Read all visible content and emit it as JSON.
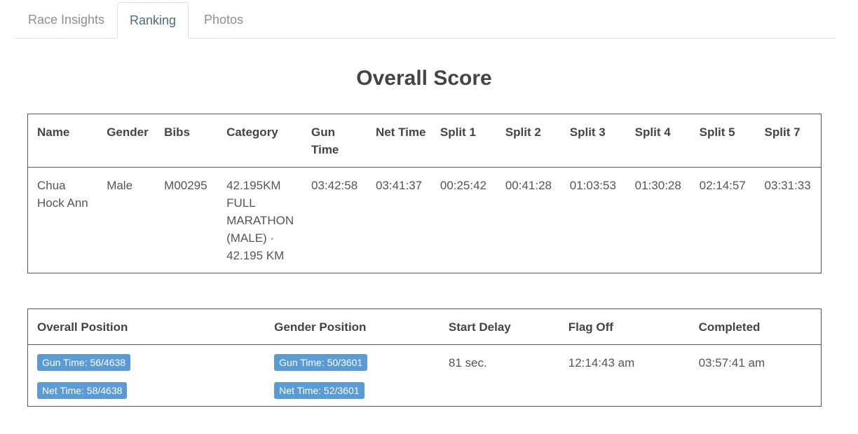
{
  "tabs": [
    {
      "label": "Race Insights"
    },
    {
      "label": "Ranking"
    },
    {
      "label": "Photos"
    }
  ],
  "title": "Overall Score",
  "score_table": {
    "headers": [
      "Name",
      "Gender",
      "Bibs",
      "Category",
      "Gun Time",
      "Net Time",
      "Split 1",
      "Split 2",
      "Split 3",
      "Split 4",
      "Split 5",
      "Split 7"
    ],
    "row": {
      "name": "Chua Hock Ann",
      "gender": "Male",
      "bib": "M00295",
      "category": "42.195KM FULL MARATHON (MALE) · 42.195 KM",
      "gun_time": "03:42:58",
      "net_time": "03:41:37",
      "split_1": "00:25:42",
      "split_2": "00:41:28",
      "split_3": "01:03:53",
      "split_4": "01:30:28",
      "split_5": "02:14:57",
      "split_7": "03:31:33"
    }
  },
  "position_table": {
    "headers": [
      "Overall Position",
      "Gender Position",
      "Start Delay",
      "Flag Off",
      "Completed"
    ],
    "overall": {
      "gun": "Gun Time: 56/4638",
      "net": "Net Time: 58/4638"
    },
    "gender": {
      "gun": "Gun Time: 50/3601",
      "net": "Net Time: 52/3601"
    },
    "start_delay": "81 sec.",
    "flag_off": "12:14:43 am",
    "completed": "03:57:41 am"
  },
  "colors": {
    "badge": "#5b9bd5",
    "active_tab": "#4f6a86",
    "inactive_tab": "#9a8a8a"
  }
}
